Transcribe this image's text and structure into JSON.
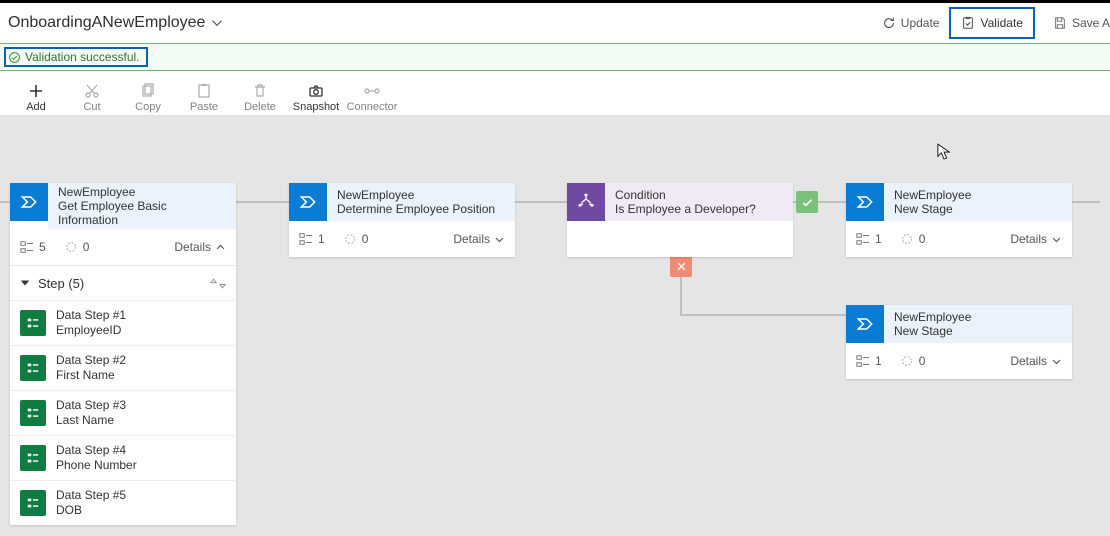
{
  "header": {
    "title": "OnboardingANewEmployee",
    "buttons": {
      "update": "Update",
      "validate": "Validate",
      "saveAs": "Save A"
    }
  },
  "status": {
    "message": "Validation successful."
  },
  "commands": {
    "add": "Add",
    "cut": "Cut",
    "copy": "Copy",
    "paste": "Paste",
    "delete": "Delete",
    "snapshot": "Snapshot",
    "connector": "Connector"
  },
  "stages": {
    "s1": {
      "entity": "NewEmployee",
      "name": "Get Employee Basic Information",
      "stepsIcon": "5",
      "branches": "0",
      "details": "Details",
      "stepsHeader": "Step (5)",
      "steps": [
        {
          "title": "Data Step #1",
          "field": "EmployeeID"
        },
        {
          "title": "Data Step #2",
          "field": "First Name"
        },
        {
          "title": "Data Step #3",
          "field": "Last Name"
        },
        {
          "title": "Data Step #4",
          "field": "Phone Number"
        },
        {
          "title": "Data Step #5",
          "field": "DOB"
        }
      ]
    },
    "s2": {
      "entity": "NewEmployee",
      "name": "Determine Employee Position",
      "stepsIcon": "1",
      "branches": "0",
      "details": "Details"
    },
    "cond": {
      "entity": "Condition",
      "name": "Is Employee a Developer?"
    },
    "s3": {
      "entity": "NewEmployee",
      "name": "New Stage",
      "stepsIcon": "1",
      "branches": "0",
      "details": "Details"
    },
    "s4": {
      "entity": "NewEmployee",
      "name": "New Stage",
      "stepsIcon": "1",
      "branches": "0",
      "details": "Details"
    }
  },
  "colors": {
    "accent": "#0862b3",
    "stageBlue": "#0a7cd4",
    "stagePurple": "#7049a3",
    "yes": "#7ac27a",
    "no": "#ef8c74",
    "stepGreen": "#107c41"
  }
}
